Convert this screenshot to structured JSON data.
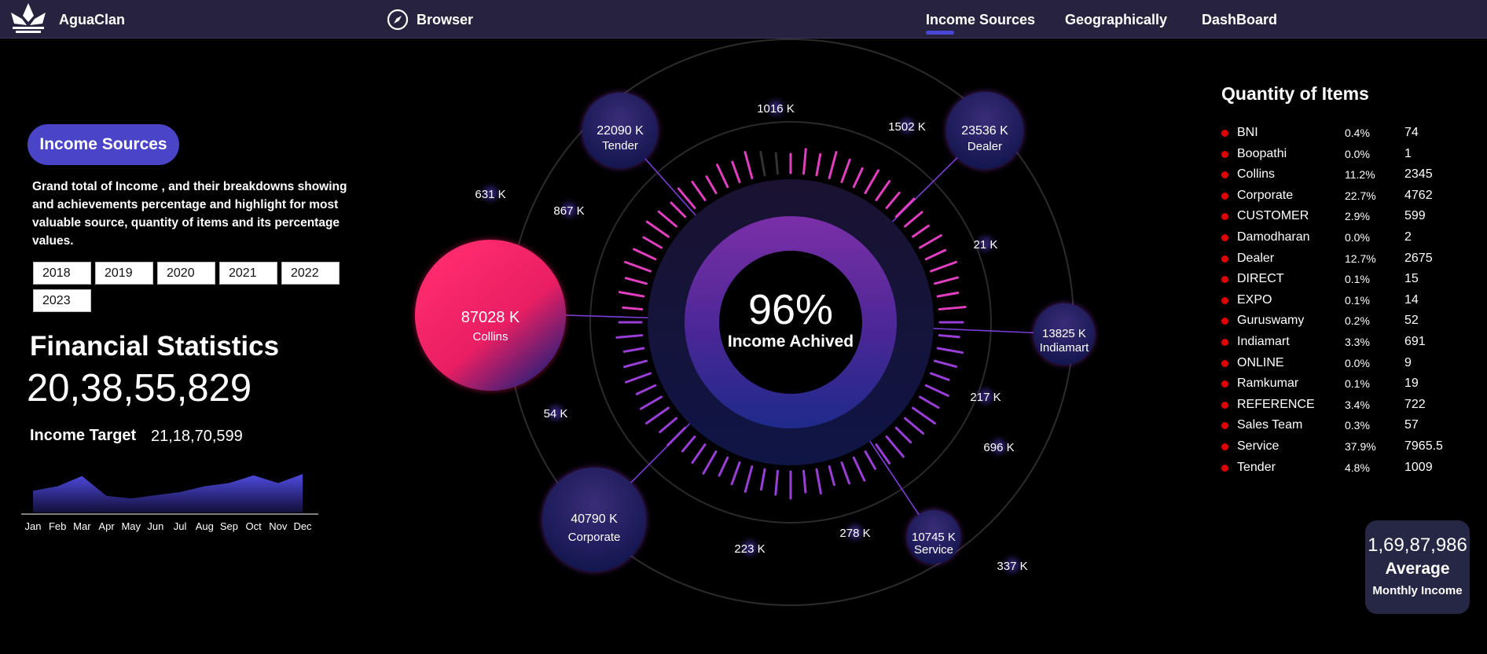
{
  "header": {
    "brand": "AguaClan",
    "browser_label": "Browser",
    "nav": [
      {
        "label": "Income Sources",
        "active": true
      },
      {
        "label": "Geographically",
        "active": false
      },
      {
        "label": "DashBoard",
        "active": false
      }
    ]
  },
  "left_panel": {
    "pill_label": "Income Sources",
    "description": "Grand total of Income , and their breakdowns showing and achievements percentage and highlight for most valuable source, quantity of items and its percentage values.",
    "years": [
      "2018",
      "2019",
      "2020",
      "2021",
      "2022",
      "2023"
    ],
    "financial_title": "Financial Statistics",
    "grand_total": "20,38,55,829",
    "income_target_label": "Income Target",
    "income_target_value": "21,18,70,599"
  },
  "chart_data": [
    {
      "type": "area",
      "categories": [
        "Jan",
        "Feb",
        "Mar",
        "Apr",
        "May",
        "Jun",
        "Jul",
        "Aug",
        "Sep",
        "Oct",
        "Nov",
        "Dec"
      ],
      "values": [
        34,
        41,
        57,
        26,
        22,
        27,
        32,
        41,
        46,
        58,
        46,
        60
      ],
      "ylim": [
        0,
        70
      ],
      "grid": false,
      "color": "#4f4be0"
    },
    {
      "type": "gauge",
      "center_value": "96%",
      "center_label": "Income Achived",
      "percent": 96
    }
  ],
  "bubbles": [
    {
      "value": "87028 K",
      "label": "Collins"
    },
    {
      "value": "22090 K",
      "label": "Tender"
    },
    {
      "value": "23536 K",
      "label": "Dealer"
    },
    {
      "value": "13825 K",
      "label": "Indiamart"
    },
    {
      "value": "10745 K",
      "label": "Service"
    },
    {
      "value": "40790 K",
      "label": "Corporate"
    }
  ],
  "small_values": [
    "1016 K",
    "1502 K",
    "631 K",
    "867 K",
    "21 K",
    "217 K",
    "696 K",
    "54 K",
    "278 K",
    "223 K",
    "337 K"
  ],
  "quantity": {
    "title": "Quantity of Items",
    "rows": [
      {
        "name": "BNI",
        "pct": "0.4%",
        "count": "74"
      },
      {
        "name": "Boopathi",
        "pct": "0.0%",
        "count": "1"
      },
      {
        "name": "Collins",
        "pct": "11.2%",
        "count": "2345"
      },
      {
        "name": "Corporate",
        "pct": "22.7%",
        "count": "4762"
      },
      {
        "name": "CUSTOMER",
        "pct": "2.9%",
        "count": "599"
      },
      {
        "name": "Damodharan",
        "pct": "0.0%",
        "count": "2"
      },
      {
        "name": "Dealer",
        "pct": "12.7%",
        "count": "2675"
      },
      {
        "name": "DIRECT",
        "pct": "0.1%",
        "count": "15"
      },
      {
        "name": "EXPO",
        "pct": "0.1%",
        "count": "14"
      },
      {
        "name": "Guruswamy",
        "pct": "0.2%",
        "count": "52"
      },
      {
        "name": "Indiamart",
        "pct": "3.3%",
        "count": "691"
      },
      {
        "name": "ONLINE",
        "pct": "0.0%",
        "count": "9"
      },
      {
        "name": "Ramkumar",
        "pct": "0.1%",
        "count": "19"
      },
      {
        "name": "REFERENCE",
        "pct": "3.4%",
        "count": "722"
      },
      {
        "name": "Sales Team",
        "pct": "0.3%",
        "count": "57"
      },
      {
        "name": "Service",
        "pct": "37.9%",
        "count": "7965.5"
      },
      {
        "name": "Tender",
        "pct": "4.8%",
        "count": "1009"
      }
    ]
  },
  "average": {
    "value": "1,69,87,986",
    "label1": "Average",
    "label2": "Monthly Income"
  }
}
